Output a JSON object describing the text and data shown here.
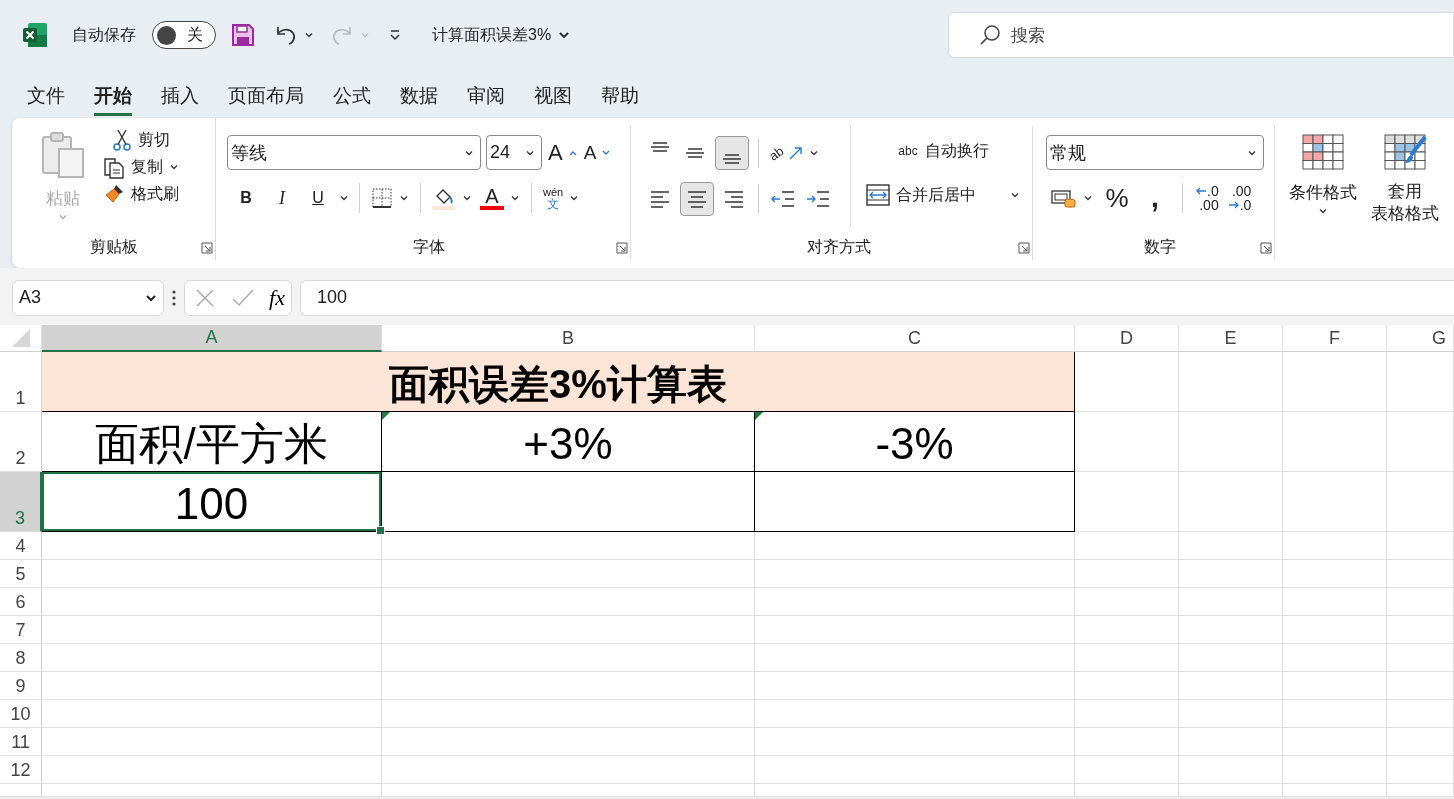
{
  "title_bar": {
    "autosave": {
      "label": "自动保存",
      "on": false,
      "state_label": "关"
    },
    "undo": {
      "disabled": false
    },
    "redo": {
      "disabled": true
    },
    "document_title": "计算面积误差3%",
    "search": {
      "placeholder": "搜索"
    }
  },
  "menu_tabs": [
    {
      "label": "文件",
      "selected": false
    },
    {
      "label": "开始",
      "selected": true
    },
    {
      "label": "插入",
      "selected": false
    },
    {
      "label": "页面布局",
      "selected": false
    },
    {
      "label": "公式",
      "selected": false
    },
    {
      "label": "数据",
      "selected": false
    },
    {
      "label": "审阅",
      "selected": false
    },
    {
      "label": "视图",
      "selected": false
    },
    {
      "label": "帮助",
      "selected": false
    }
  ],
  "ribbon": {
    "clipboard": {
      "label": "剪贴板",
      "paste": {
        "label": "粘贴",
        "disabled": true
      },
      "cut": "剪切",
      "copy": "复制",
      "format_painter": "格式刷"
    },
    "font": {
      "label": "字体",
      "font_name": "等线",
      "font_size": "24",
      "grow_font": "A",
      "shrink_font": "A",
      "bold": "B",
      "italic": "I",
      "underline": "U",
      "font_color": "A",
      "phonetic_guide": "wén",
      "phonetic_char": "文"
    },
    "alignment": {
      "label": "对齐方式",
      "vertical_align": [
        {
          "selected": false
        },
        {
          "selected": false
        },
        {
          "selected": true
        }
      ],
      "orientation": "ab",
      "horizontal_align": [
        {
          "selected": false
        },
        {
          "selected": true
        },
        {
          "selected": false
        }
      ],
      "wrap_text": {
        "icon_text": "abc",
        "label": "自动换行"
      },
      "merge_center": "合并后居中"
    },
    "number": {
      "label": "数字",
      "format": "常规",
      "percent": "%",
      "comma": ",",
      "increase_decimal": [
        ".0",
        ".00"
      ],
      "decrease_decimal": [
        ".00",
        ".0"
      ]
    },
    "styles": {
      "conditional_formatting": "条件格式",
      "format_as_table": [
        "套用",
        "表格格式"
      ]
    }
  },
  "formula_bar": {
    "name_box": "A3",
    "function_label": "fx",
    "formula": "100"
  },
  "sheet": {
    "columns": [
      {
        "label": "A",
        "selected": true
      },
      {
        "label": "B",
        "selected": false
      },
      {
        "label": "C",
        "selected": false
      },
      {
        "label": "D",
        "selected": false
      },
      {
        "label": "E",
        "selected": false
      },
      {
        "label": "F",
        "selected": false
      },
      {
        "label": "G",
        "selected": false
      }
    ],
    "rows": [
      {
        "label": "1",
        "selected": false,
        "cells": [
          {
            "kind": "merged",
            "text": "面积误差3%计算表",
            "selected": false,
            "error_marker": false
          }
        ]
      },
      {
        "label": "2",
        "selected": false,
        "cells": [
          {
            "kind": "cell",
            "text": "面积/平方米",
            "selected": false,
            "error_marker": false
          },
          {
            "kind": "cell",
            "text": "+3%",
            "selected": false,
            "error_marker": true
          },
          {
            "kind": "cell",
            "text": "-3%",
            "selected": false,
            "error_marker": true
          }
        ]
      },
      {
        "label": "3",
        "selected": true,
        "cells": [
          {
            "kind": "cell",
            "text": "100",
            "selected": true,
            "error_marker": false
          },
          {
            "kind": "cell",
            "selected": false,
            "error_marker": false
          },
          {
            "kind": "cell",
            "selected": false,
            "error_marker": false
          }
        ]
      },
      {
        "label": "4",
        "selected": false
      },
      {
        "label": "5",
        "selected": false
      },
      {
        "label": "6",
        "selected": false
      },
      {
        "label": "7",
        "selected": false
      },
      {
        "label": "8",
        "selected": false
      },
      {
        "label": "9",
        "selected": false
      },
      {
        "label": "10",
        "selected": false
      },
      {
        "label": "11",
        "selected": false
      },
      {
        "label": "12",
        "selected": false
      }
    ]
  }
}
